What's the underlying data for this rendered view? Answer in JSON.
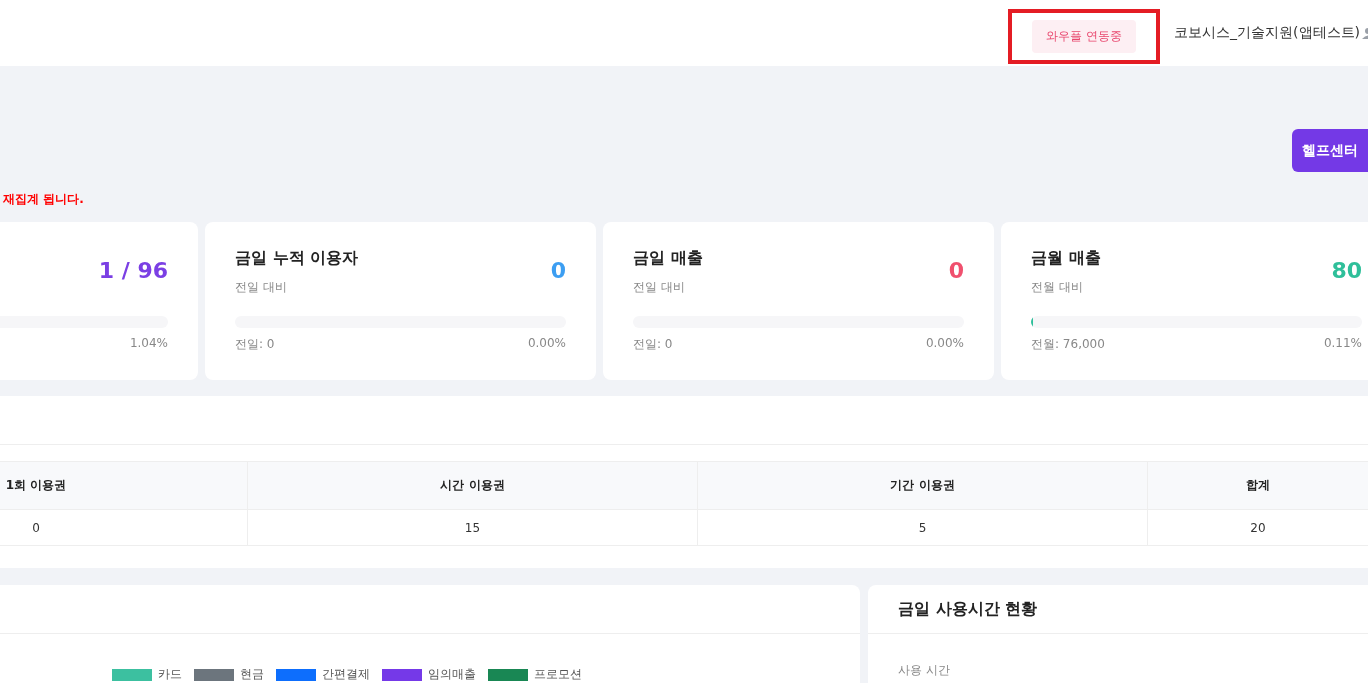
{
  "header": {
    "status_badge": {
      "label": "와우플 연동중",
      "highlighted": true
    },
    "user_name": "코보시스_기술지원(앱테스트)"
  },
  "help_button": "헬프센터",
  "notice": "재집계 됩니다.",
  "stat_cards": [
    {
      "value": "1 / 96",
      "color": "#7b3fe4",
      "percent": "1.04%"
    },
    {
      "title": "금일 누적 이용자",
      "subtitle": "전일 대비",
      "value": "0",
      "color": "#3c9ef2",
      "previous": "전일: 0",
      "percent": "0.00%"
    },
    {
      "title": "금일 매출",
      "subtitle": "전일 대비",
      "value": "0",
      "color": "#f0506e",
      "previous": "전일: 0",
      "percent": "0.00%"
    },
    {
      "title": "금월 매출",
      "subtitle": "전월 대비",
      "value": "80",
      "color": "#2fbf9a",
      "level": 0.0011,
      "previous": "전월: 76,000",
      "percent": "0.11%"
    }
  ],
  "ticket_table": {
    "columns": [
      "1회 이용권",
      "시간 이용권",
      "기간 이용권",
      "합계"
    ],
    "rows": [
      [
        "0",
        "15",
        "5",
        "20"
      ]
    ]
  },
  "sales_panel": {
    "legend": [
      {
        "label": "카드",
        "color": "#3cc0a0"
      },
      {
        "label": "현금",
        "color": "#6c757d"
      },
      {
        "label": "간편결제",
        "color": "#0d6efd"
      },
      {
        "label": "임의매출",
        "color": "#7539e8"
      },
      {
        "label": "프로모션",
        "color": "#198754"
      }
    ]
  },
  "usage_panel": {
    "title": "금일 사용시간 현황",
    "label": "사용 시간"
  }
}
